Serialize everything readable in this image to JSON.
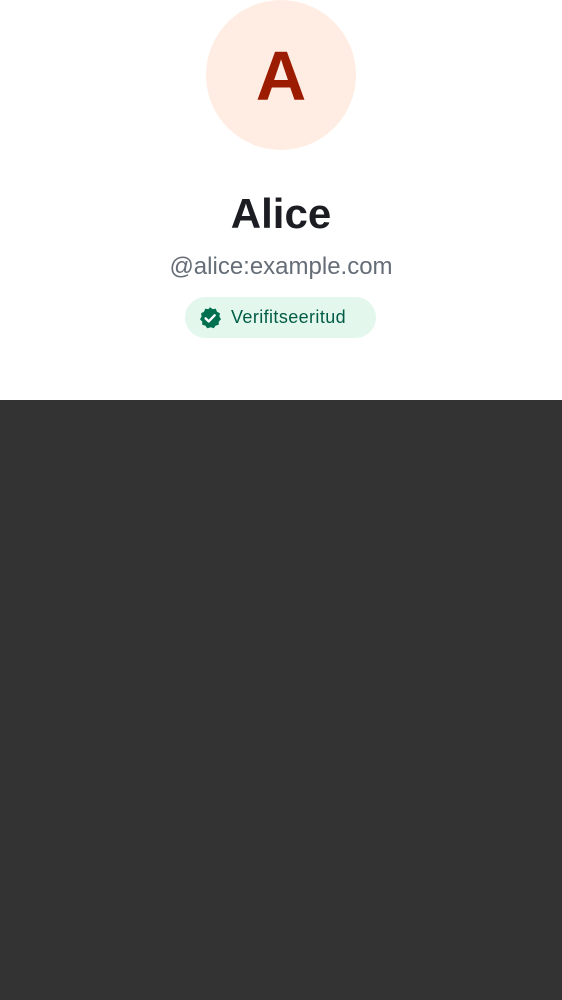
{
  "profile": {
    "avatar_initial": "A",
    "display_name": "Alice",
    "user_id": "@alice:example.com",
    "verification": {
      "label": "Verifitseeritud",
      "icon": "verified-badge-icon"
    }
  },
  "colors": {
    "avatar_background": "#ffede3",
    "avatar_text": "#9b1c00",
    "badge_background": "#e3f7ed",
    "badge_text": "#005c45",
    "backdrop": "#333333"
  }
}
